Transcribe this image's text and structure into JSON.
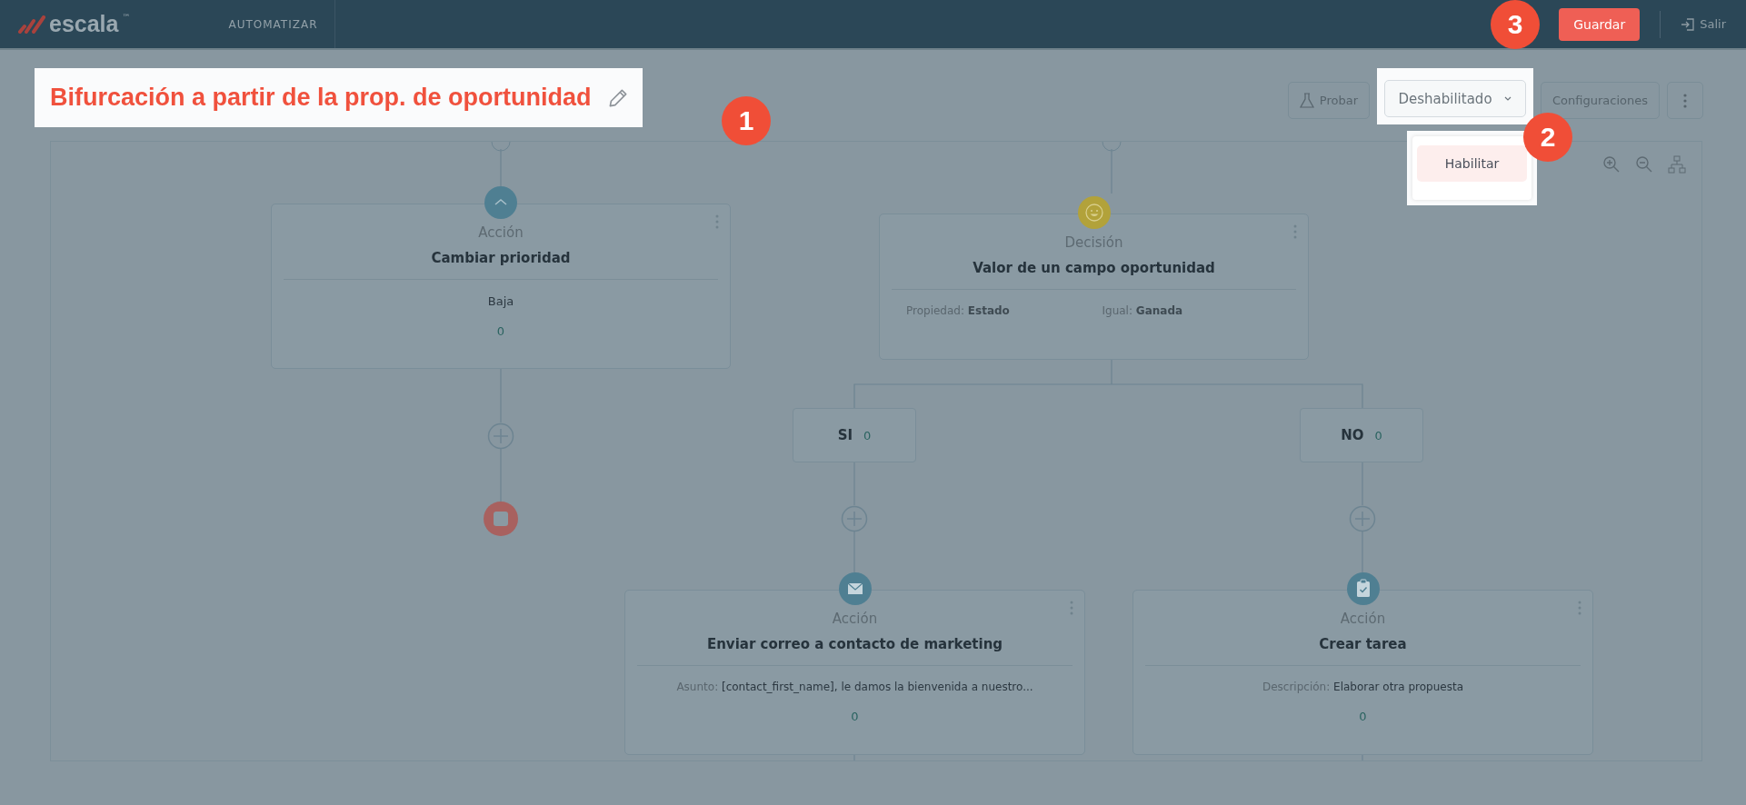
{
  "header": {
    "logo": "escala",
    "logo_mark": "™",
    "section": "AUTOMATIZAR",
    "save_button": "Guardar",
    "exit_link": "Salir"
  },
  "title": "Bifurcación a partir de la prop. de oportunidad",
  "toolbar": {
    "test_button": "Probar",
    "status_dropdown": {
      "value": "Deshabilitado",
      "expanded": true,
      "options": [
        {
          "label": "Habilitar",
          "hovered": true
        }
      ]
    },
    "settings_button": "Configuraciones"
  },
  "nodes": [
    {
      "kind": "action",
      "type_label": "Acción",
      "title": "Cambiar prioridad",
      "details": [
        {
          "value": "Baja"
        }
      ],
      "count": "0"
    },
    {
      "kind": "decision",
      "type_label": "Decisión",
      "title": "Valor de un campo oportunidad",
      "details": [
        {
          "label": "Propiedad:",
          "value": "Estado"
        },
        {
          "label": "Igual:",
          "value": "Ganada"
        }
      ]
    },
    {
      "kind": "action",
      "type_label": "Acción",
      "title": "Enviar correo a contacto de marketing",
      "details": [
        {
          "label": "Asunto:",
          "value": "[contact_first_name], le damos la bienvenida a nuestro..."
        }
      ],
      "count": "0"
    },
    {
      "kind": "action",
      "type_label": "Acción",
      "title": "Crear tarea",
      "details": [
        {
          "label": "Descripción:",
          "value": "Elaborar otra propuesta"
        }
      ],
      "count": "0"
    }
  ],
  "branches": [
    {
      "label": "SI",
      "count": "0"
    },
    {
      "label": "NO",
      "count": "0"
    }
  ],
  "callouts": [
    {
      "number": "1"
    },
    {
      "number": "2"
    },
    {
      "number": "3"
    }
  ]
}
